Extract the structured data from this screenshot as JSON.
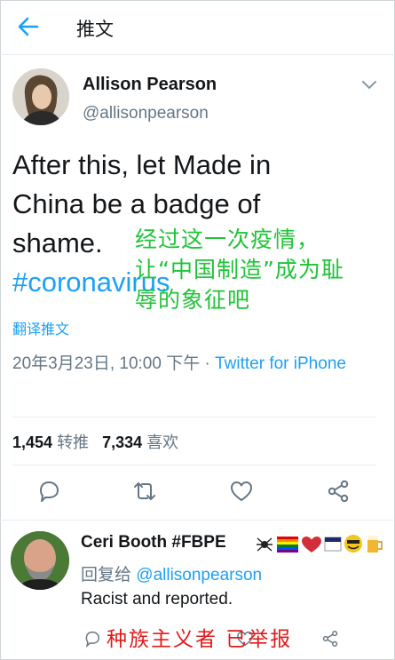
{
  "header": {
    "title": "推文",
    "back_icon": "arrow-left-icon"
  },
  "tweet": {
    "author_name": "Allison Pearson",
    "author_handle": "@allisonpearson",
    "text_line1": "After this, let Made in",
    "text_line2": "China be a badge of",
    "text_line3": "shame.",
    "hashtag": "#coronavirus",
    "overlay_line1": "经过这一次疫情，",
    "overlay_line2": "让“中国制造”成为耻",
    "overlay_line3": "辱的象征吧",
    "translate_label": "翻译推文",
    "timestamp": "20年3月23日, 10:00 下午 · ",
    "source": "Twitter for iPhone",
    "retweets_count": "1,454",
    "retweets_label": "转推",
    "likes_count": "7,334",
    "likes_label": "喜欢"
  },
  "reply": {
    "author_name": "Ceri Booth #FBPE",
    "replying_to_label": "回复给 ",
    "replying_to_handle": "@allisonpearson",
    "text": "Racist and reported.",
    "overlay": "种族主义者 已举报"
  },
  "colors": {
    "accent": "#1da1f2",
    "overlay_green": "#22c33a",
    "overlay_red": "#e21a1a",
    "muted": "#657786"
  }
}
